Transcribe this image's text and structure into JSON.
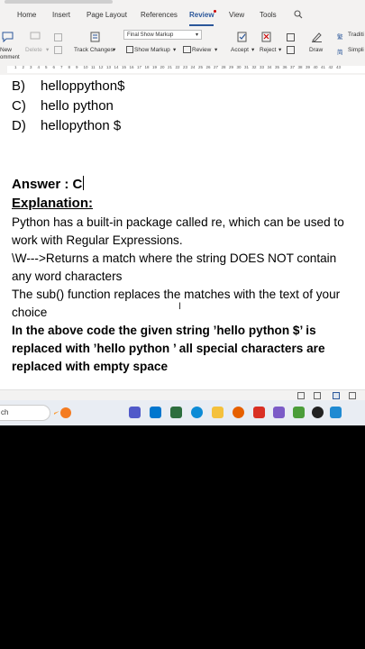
{
  "ribbon_tabs": [
    {
      "label": "Home"
    },
    {
      "label": "Insert"
    },
    {
      "label": "Page Layout"
    },
    {
      "label": "References"
    },
    {
      "label": "Review"
    },
    {
      "label": "View"
    },
    {
      "label": "Tools"
    }
  ],
  "ribbon": {
    "new_comment": "New",
    "new_comment_2": "omment",
    "delete": "Delete",
    "track_changes": "Track Changes",
    "markup_dropdown": "Final Show Markup",
    "show_markup": "Show Markup",
    "review": "Review",
    "accept": "Accept",
    "reject": "Reject",
    "draw": "Draw",
    "traditional": "Traditi",
    "simplified": "Simpli"
  },
  "ruler_numbers": [
    "1",
    "2",
    "3",
    "4",
    "5",
    "6",
    "7",
    "8",
    "9",
    "10",
    "11",
    "12",
    "13",
    "14",
    "15",
    "16",
    "17",
    "18",
    "19",
    "20",
    "21",
    "22",
    "23",
    "24",
    "25",
    "26",
    "27",
    "28",
    "29",
    "30",
    "31",
    "32",
    "33",
    "34",
    "35",
    "36",
    "37",
    "38",
    "39",
    "40",
    "41",
    "42",
    "43"
  ],
  "document": {
    "options": [
      {
        "label": "B)",
        "text": "helloppython$"
      },
      {
        "label": "C)",
        "text": "hello python"
      },
      {
        "label": "D)",
        "text": "hellopython $"
      }
    ],
    "answer": "Answer : C",
    "explanation_heading": "Explanation:",
    "paragraphs": [
      "Python has a built-in package called re, which can be used to work with Regular Expressions.",
      "\\W--->Returns a match where the string DOES NOT contain any word characters",
      "The sub() function replaces the matches with the text of your choice",
      "In the above code the given string ’hello python $’ is replaced with ’hello python ’ all special characters are replaced with empty space"
    ]
  },
  "taskbar": {
    "search_text": "ch",
    "apps": [
      {
        "icon": "weather-icon",
        "color": "#f47b20"
      },
      {
        "icon": "teams-icon",
        "color": "#5059c9"
      },
      {
        "icon": "dell-icon",
        "color": "#0076ce"
      },
      {
        "icon": "store-icon",
        "color": "#2d6e3e"
      },
      {
        "icon": "edge-icon",
        "color": "#0c8bd6"
      },
      {
        "icon": "file-explorer-icon",
        "color": "#f4c13d"
      },
      {
        "icon": "firefox-icon",
        "color": "#e66000"
      },
      {
        "icon": "wps-office-icon",
        "color": "#d93025"
      },
      {
        "icon": "photos-icon",
        "color": "#7b5bc7"
      },
      {
        "icon": "notepad-icon",
        "color": "#4b9d3a"
      },
      {
        "icon": "obs-icon",
        "color": "#222222"
      },
      {
        "icon": "vscode-icon",
        "color": "#1f8ad2"
      }
    ]
  }
}
